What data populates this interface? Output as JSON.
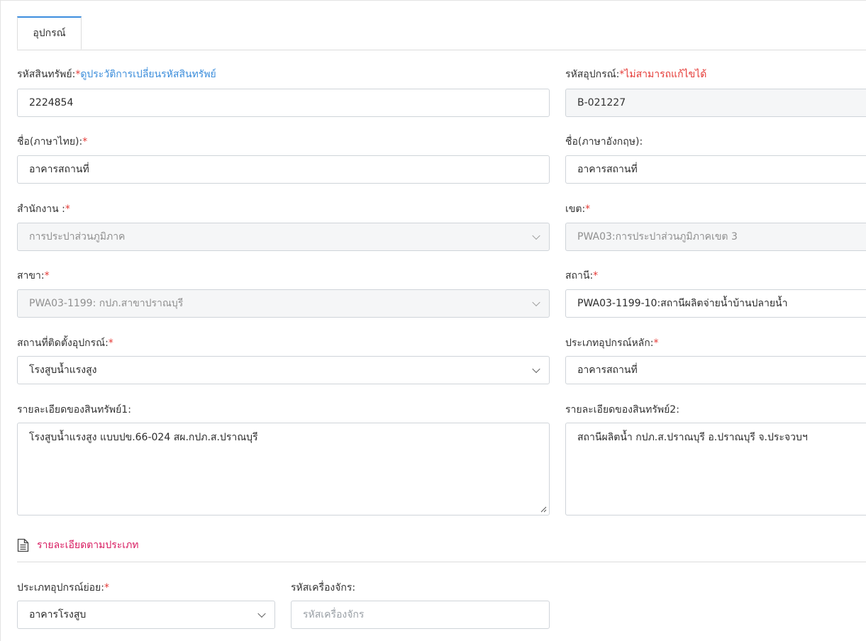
{
  "tabs": [
    {
      "label": "อุปกรณ์"
    }
  ],
  "fields": {
    "asset_code": {
      "label": "รหัสสินทรัพย์:",
      "required_mark": "*",
      "link_text": "ดูประวัติการเปลี่ยนรหัสสินทรัพย์",
      "value": "2224854"
    },
    "equipment_code": {
      "label": "รหัสอุปกรณ์:",
      "note": "*ไม่สามารถแก้ไขได้",
      "value": "B-021227"
    },
    "name_th": {
      "label": "ชื่อ(ภาษาไทย):",
      "required_mark": "*",
      "value": "อาคารสถานที่"
    },
    "name_en": {
      "label": "ชื่อ(ภาษาอังกฤษ):",
      "value": "อาคารสถานที่"
    },
    "office": {
      "label": "สำนักงาน :",
      "required_mark": "*",
      "value": "การประปาส่วนภูมิภาค"
    },
    "zone": {
      "label": "เขต:",
      "required_mark": "*",
      "value": "PWA03:การประปาส่วนภูมิภาคเขต 3"
    },
    "branch": {
      "label": "สาขา:",
      "required_mark": "*",
      "value": "PWA03-1199: กปภ.สาขาปราณบุรี"
    },
    "station": {
      "label": "สถานี:",
      "required_mark": "*",
      "value": "PWA03-1199-10:สถานีผลิตจ่ายน้ำบ้านปลายน้ำ"
    },
    "install_location": {
      "label": "สถานที่ติดตั้งอุปกรณ์:",
      "required_mark": "*",
      "value": "โรงสูบน้ำแรงสูง"
    },
    "main_type": {
      "label": "ประเภทอุปกรณ์หลัก:",
      "required_mark": "*",
      "value": "อาคารสถานที่"
    },
    "asset_detail_1": {
      "label": "รายละเอียดของสินทรัพย์1:",
      "value": "โรงสูบน้ำแรงสูง แบบปข.66-024 สผ.กปภ.ส.ปราณบุรี"
    },
    "asset_detail_2": {
      "label": "รายละเอียดของสินทรัพย์2:",
      "value": "สถานีผลิตน้ำ กปภ.ส.ปราณบุรี อ.ปราณบุรี จ.ประจวบฯ"
    },
    "sub_type": {
      "label": "ประเภทอุปกรณ์ย่อย:",
      "required_mark": "*",
      "value": "อาคารโรงสูบ"
    },
    "machine_code": {
      "label": "รหัสเครื่องจักร:",
      "placeholder": "รหัสเครื่องจักร",
      "value": ""
    }
  },
  "section": {
    "title": "รายละเอียดตามประเภท",
    "icon": "document-icon"
  },
  "colors": {
    "accent": "#3c8dde",
    "required": "#e53935",
    "link": "#3b8ddb",
    "section_title": "#d81b60"
  }
}
